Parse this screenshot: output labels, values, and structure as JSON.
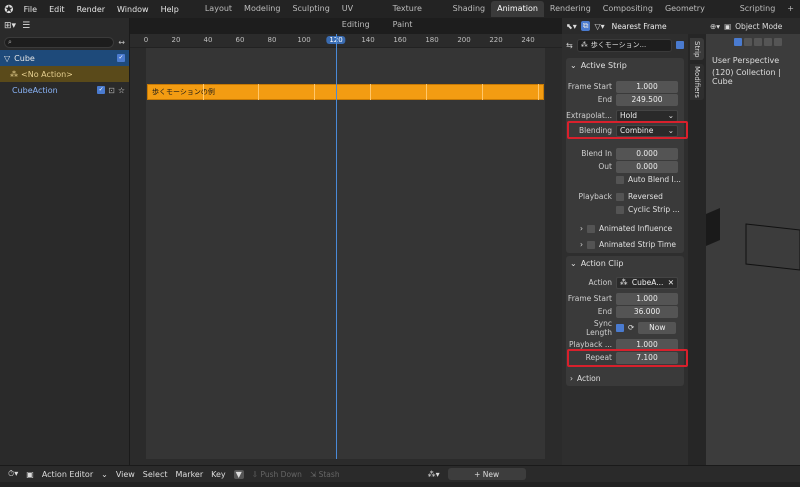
{
  "topbar": {
    "menus": [
      "File",
      "Edit",
      "Render",
      "Window",
      "Help"
    ],
    "workspaces": [
      "Layout",
      "Modeling",
      "Sculpting",
      "UV Editing",
      "Texture Paint",
      "Shading",
      "Animation",
      "Rendering",
      "Compositing",
      "Geometry Nodes",
      "Scripting",
      "+"
    ],
    "active_workspace": "Animation"
  },
  "channels": {
    "items": [
      {
        "label": "Cube",
        "type": "object"
      },
      {
        "label": "<No Action>",
        "type": "no-action"
      },
      {
        "label": "CubeAction",
        "type": "action"
      }
    ]
  },
  "ruler": {
    "ticks": [
      "0",
      "20",
      "40",
      "60",
      "80",
      "100",
      "120",
      "140",
      "160",
      "180",
      "200",
      "220",
      "240"
    ],
    "current_frame": "120"
  },
  "strip": {
    "label": "歩くモーションの例"
  },
  "header_right": {
    "snap_label": "Nearest Frame",
    "datablock": "歩くモーション..."
  },
  "tabs": [
    "Strip",
    "Modifiers"
  ],
  "active_strip": {
    "title": "Active Strip",
    "frame_start_label": "Frame Start",
    "frame_start": "1.000",
    "end_label": "End",
    "end": "249.500",
    "extrapolation_label": "Extrapolat...",
    "extrapolation": "Hold",
    "blending_label": "Blending",
    "blending": "Combine",
    "blend_in_label": "Blend In",
    "blend_in": "0.000",
    "out_label": "Out",
    "out": "0.000",
    "auto_blend_label": "Auto Blend I...",
    "playback_label": "Playback",
    "reversed_label": "Reversed",
    "cyclic_label": "Cyclic Strip ...",
    "animated_influence_label": "Animated Influence",
    "animated_strip_time_label": "Animated Strip Time"
  },
  "action_clip": {
    "title": "Action Clip",
    "action_label": "Action",
    "action_value": "CubeA...",
    "frame_start_label": "Frame Start",
    "frame_start": "1.000",
    "end_label": "End",
    "end": "36.000",
    "sync_length_label": "Sync Length",
    "now_label": "Now",
    "playback_label": "Playback ...",
    "playback_value": "1.000",
    "repeat_label": "Repeat",
    "repeat_value": "7.100",
    "action_section_label": "Action"
  },
  "viewport": {
    "mode": "Object Mode",
    "line1": "User Perspective",
    "line2": "(120) Collection | Cube"
  },
  "bottom": {
    "editor": "Action Editor",
    "menus": [
      "View",
      "Select",
      "Marker",
      "Key"
    ],
    "push_down": "Push Down",
    "stash": "Stash",
    "new_label": "New"
  },
  "colors": {
    "strip": "#f39c12",
    "highlight": "#d8202c",
    "playhead": "#4a8ad8"
  }
}
